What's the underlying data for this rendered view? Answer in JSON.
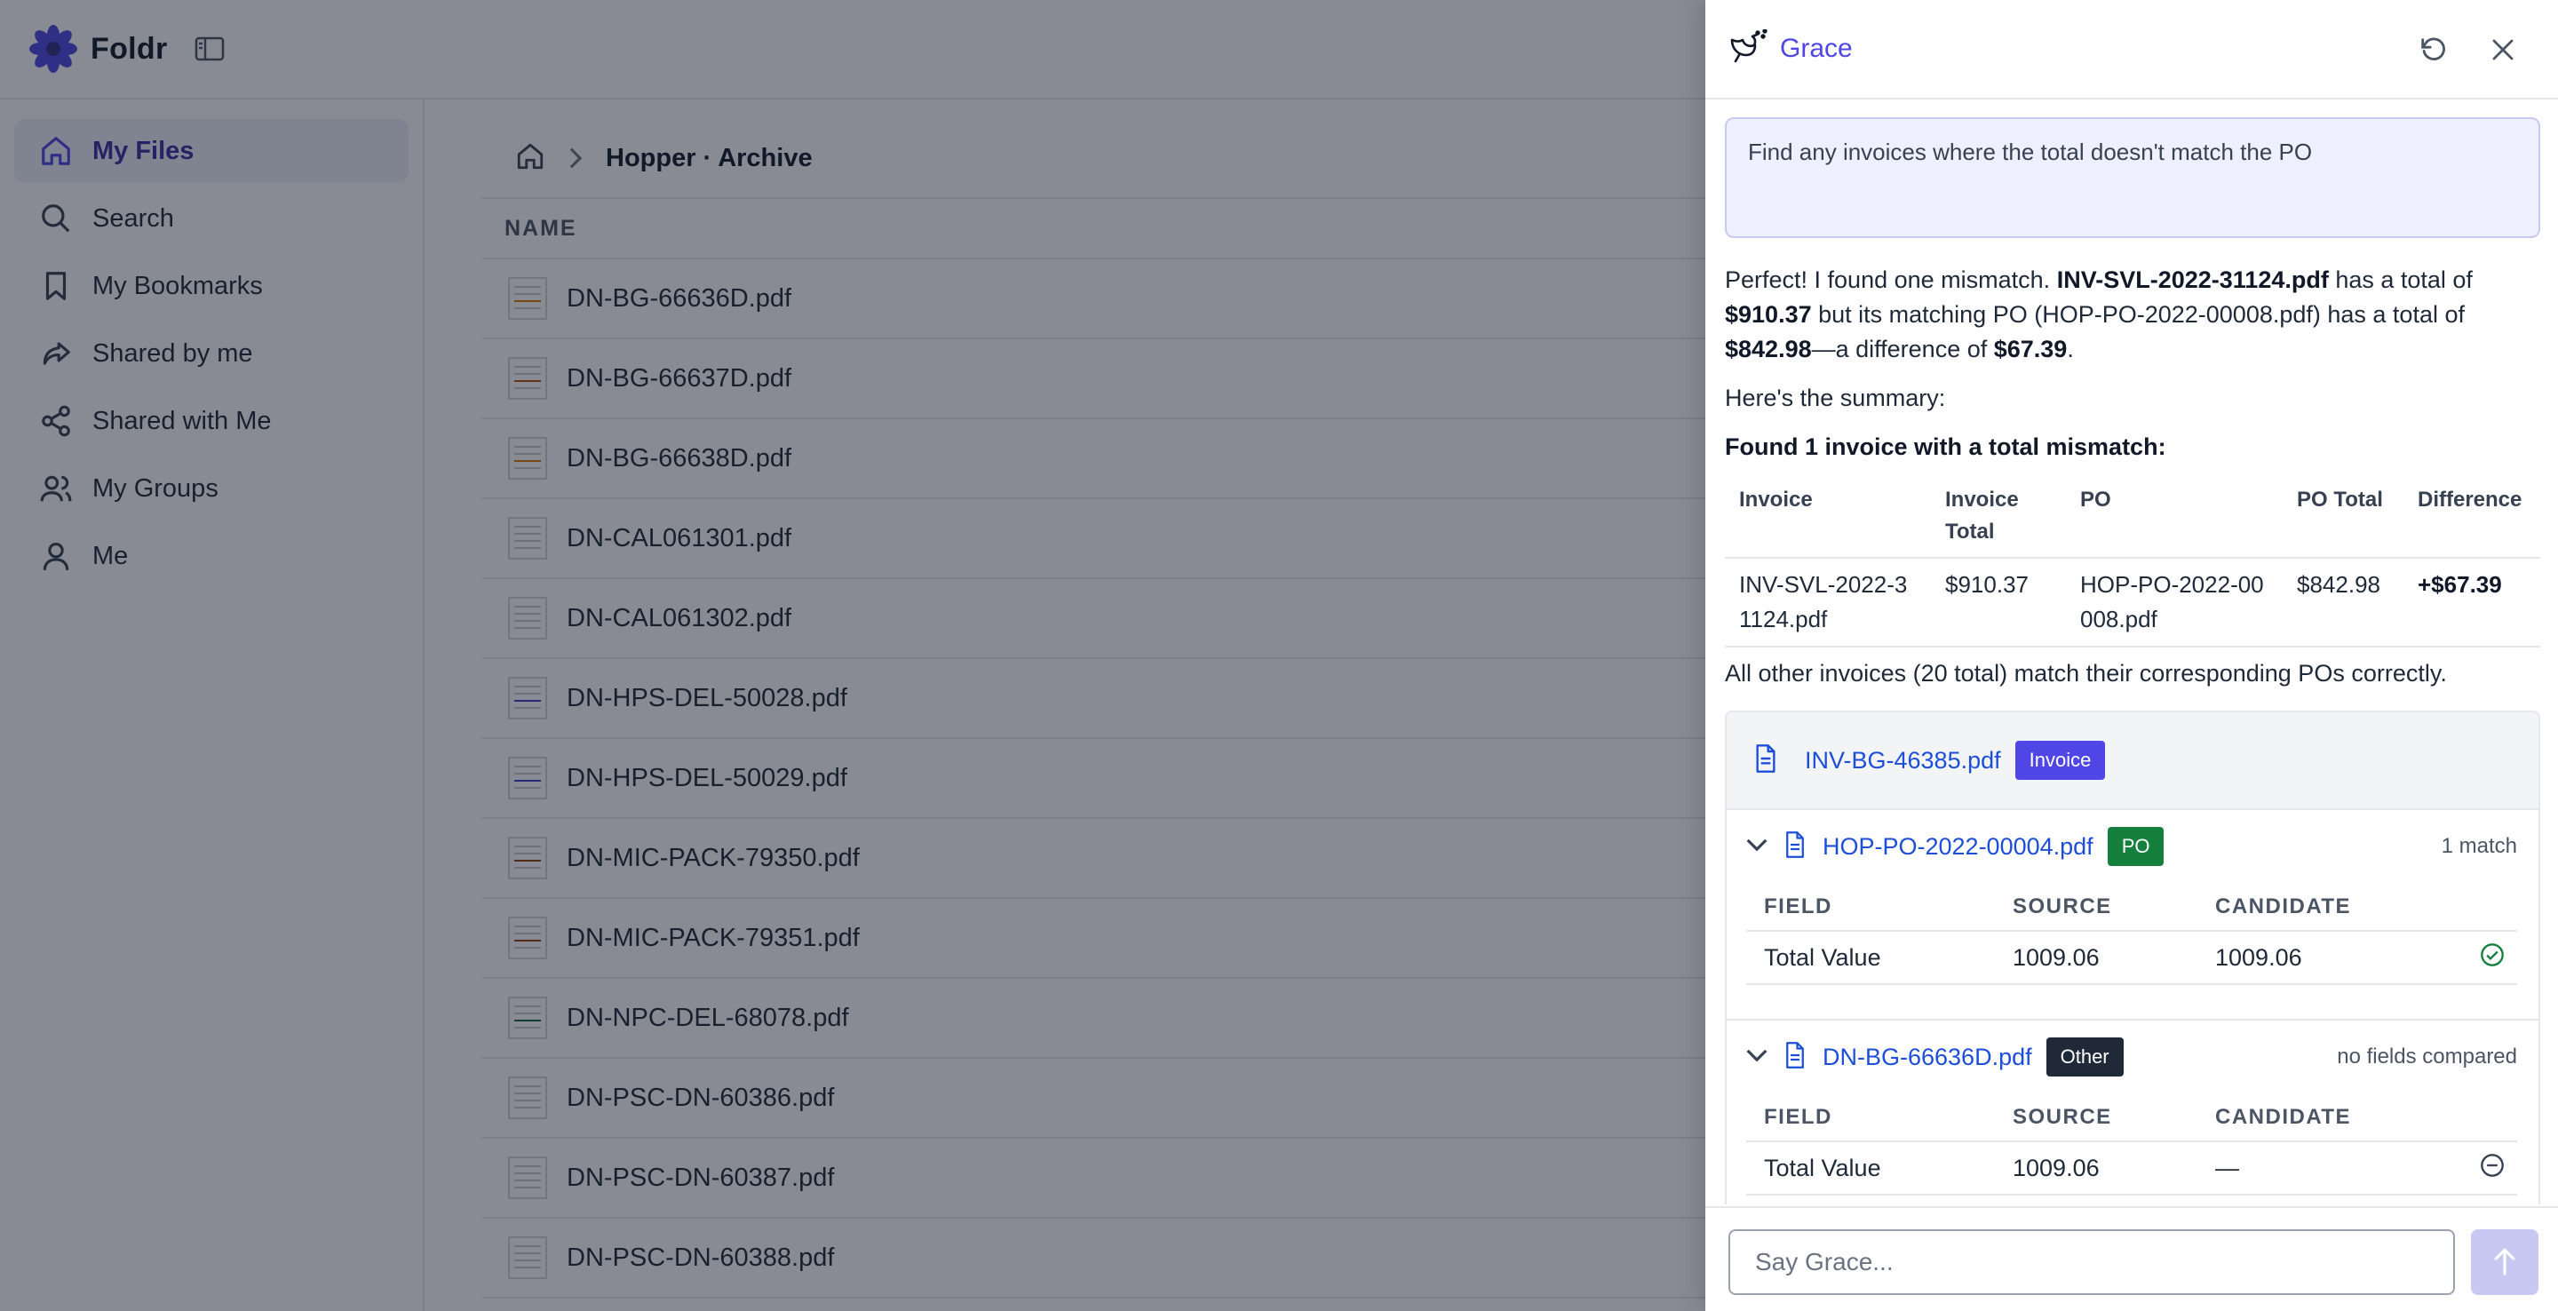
{
  "app": {
    "name": "Foldr",
    "sidebar": {
      "items": [
        {
          "label": "My Files",
          "icon": "home-icon",
          "active": true
        },
        {
          "label": "Search",
          "icon": "search-icon"
        },
        {
          "label": "My Bookmarks",
          "icon": "bookmark-icon"
        },
        {
          "label": "Shared by me",
          "icon": "share-forward-icon"
        },
        {
          "label": "Shared with Me",
          "icon": "share-nodes-icon"
        },
        {
          "label": "My Groups",
          "icon": "users-icon"
        },
        {
          "label": "Me",
          "icon": "user-icon"
        }
      ]
    },
    "breadcrumb": {
      "current": "Hopper · Archive"
    },
    "table": {
      "name_header": "NAME",
      "files": [
        "DN-BG-66636D.pdf",
        "DN-BG-66637D.pdf",
        "DN-BG-66638D.pdf",
        "DN-CAL061301.pdf",
        "DN-CAL061302.pdf",
        "DN-HPS-DEL-50028.pdf",
        "DN-HPS-DEL-50029.pdf",
        "DN-MIC-PACK-79350.pdf",
        "DN-MIC-PACK-79351.pdf",
        "DN-NPC-DEL-68078.pdf",
        "DN-PSC-DN-60386.pdf",
        "DN-PSC-DN-60387.pdf",
        "DN-PSC-DN-60388.pdf"
      ]
    }
  },
  "colors": {
    "accent": "#4f46e5",
    "link": "#1d4ed8",
    "po_badge": "#15803d",
    "other_badge": "#1f2937",
    "overlay": "rgba(17,24,39,0.5)"
  },
  "grace": {
    "title": "Grace",
    "prompt": "Find any invoices where the total doesn't match the PO",
    "summary_intro": "Here's the summary:",
    "found_heading": "Found 1 invoice with a total mismatch:",
    "table": {
      "headers": [
        "Invoice",
        "Invoice Total",
        "PO",
        "PO Total",
        "Difference"
      ],
      "rows": [
        [
          "INV-SVL-2022-31124.pdf",
          "$910.37",
          "HOP-PO-2022-00008.pdf",
          "$842.98",
          "+$67.39"
        ]
      ]
    },
    "footer_note": "All other invoices (20 total) match their corresponding POs correctly.",
    "match_card": {
      "source": {
        "name": "INV-BG-46385.pdf",
        "badge": "Invoice"
      },
      "field_headers": [
        "FIELD",
        "SOURCE",
        "CANDIDATE"
      ],
      "candidates": [
        {
          "name": "HOP-PO-2022-00004.pdf",
          "badge": "PO",
          "status": "1 match",
          "field": "Total Value",
          "source": "1009.06",
          "candidate": "1009.06",
          "result_icon": "check-circle-icon"
        },
        {
          "name": "DN-BG-66636D.pdf",
          "badge": "Other",
          "status": "no fields compared",
          "field": "Total Value",
          "source": "1009.06",
          "candidate": "—",
          "result_icon": "minus-circle-icon"
        }
      ]
    },
    "input_placeholder": "Say Grace..."
  }
}
